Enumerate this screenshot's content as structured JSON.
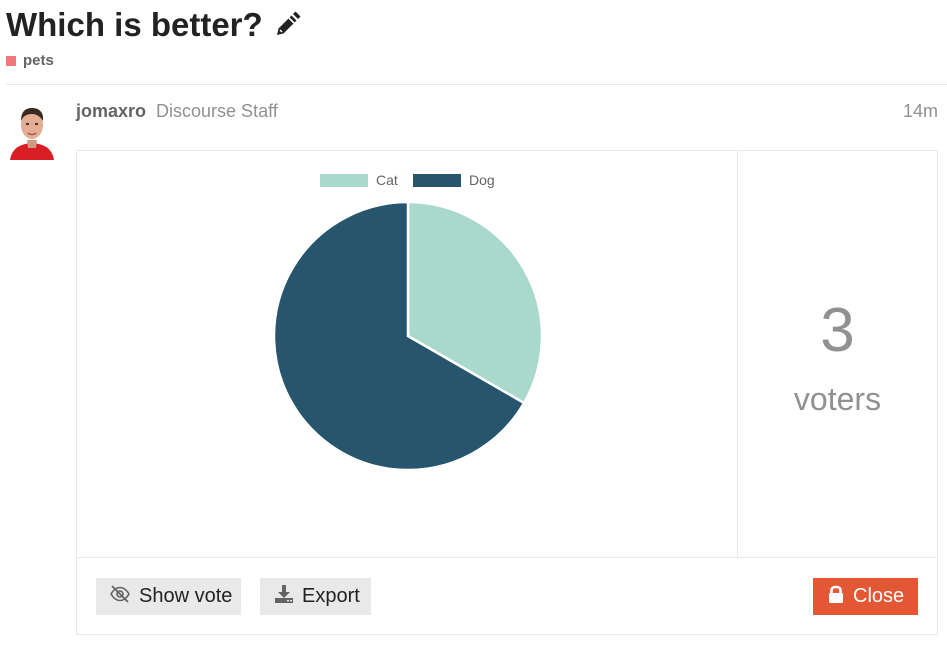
{
  "topic": {
    "title": "Which is better?",
    "category": {
      "name": "pets",
      "color": "#f0787a"
    }
  },
  "post": {
    "username": "jomaxro",
    "user_title": "Discourse Staff",
    "date": "14m"
  },
  "poll": {
    "voters_count": "3",
    "voters_label": "voters",
    "buttons": {
      "show_vote": "Show vote",
      "export": "Export",
      "close": "Close"
    }
  },
  "colors": {
    "close_button": "#e45735",
    "button_gray": "#e9e9e9",
    "muted_text": "#919191"
  },
  "icons": {
    "edit": "pencil-icon",
    "show_vote": "eye-slash-icon",
    "export": "download-icon",
    "close": "lock-icon"
  },
  "chart_data": {
    "type": "pie",
    "categories": [
      "Cat",
      "Dog"
    ],
    "values": [
      1,
      2
    ],
    "colors": [
      "#a9d9cc",
      "#27556d"
    ],
    "legend": "top"
  }
}
